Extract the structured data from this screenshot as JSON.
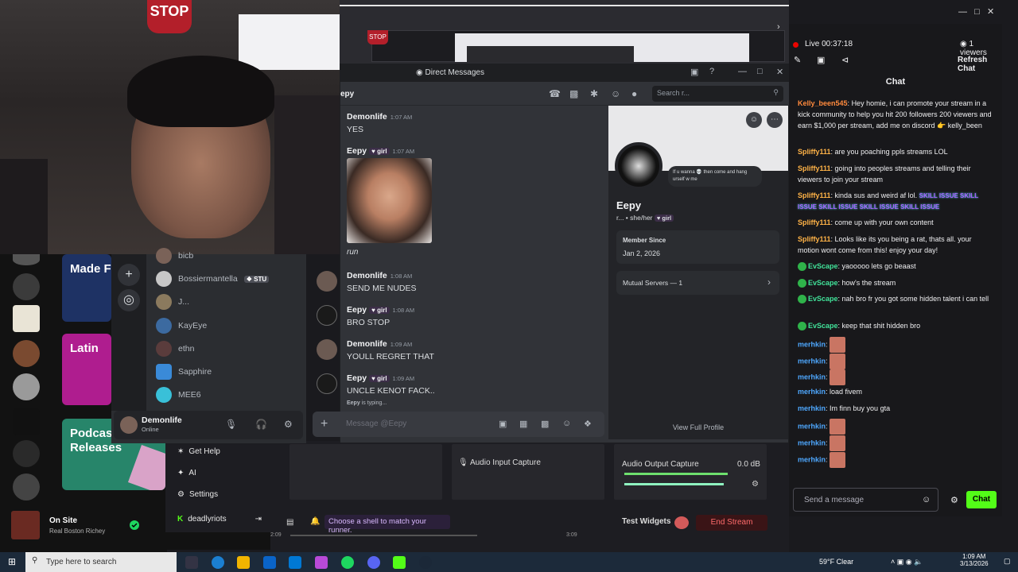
{
  "webcam": {
    "stop_sign": "STOP"
  },
  "obs_strip": {
    "stop_mini": "STOP"
  },
  "spotify": {
    "tiles": [
      {
        "label": "Made F",
        "color": "#1e3264"
      },
      {
        "label": "Latin",
        "color": "#af1d8f"
      },
      {
        "label": "Podcas Releases",
        "color": "#27856a"
      }
    ],
    "now_playing": {
      "title": "On Site",
      "artist": "Real Boston Richey"
    }
  },
  "discord": {
    "window_title": "Direct Messages",
    "channel_name": "epy",
    "search_placeholder": "Search r...",
    "dm_list": [
      {
        "name": "bicb"
      },
      {
        "name": "Bossiermantella",
        "tag": "STU"
      },
      {
        "name": "J..."
      },
      {
        "name": "KayEye"
      },
      {
        "name": "ethn"
      },
      {
        "name": "Sapphire"
      },
      {
        "name": "MEE6"
      }
    ],
    "user": {
      "name": "Demonlife",
      "status": "Online"
    },
    "messages": [
      {
        "author": "Demonlife",
        "time": "1:07 AM",
        "text": "YES"
      },
      {
        "author": "Eepy",
        "badge": "girl",
        "time": "1:07 AM",
        "text": "run"
      },
      {
        "author": "Demonlife",
        "time": "1:08 AM",
        "text": "SEND ME NUDES"
      },
      {
        "author": "Eepy",
        "badge": "girl",
        "time": "1:08 AM",
        "text": "BRO STOP"
      },
      {
        "author": "Demonlife",
        "time": "1:09 AM",
        "text": "YOULL REGRET THAT"
      },
      {
        "author": "Eepy",
        "badge": "girl",
        "time": "1:09 AM",
        "text": "UNCLE KENOT FACK.."
      }
    ],
    "typing_user": "Eepy",
    "typing_suffix": "is typing...",
    "composer_placeholder": "Message @Eepy",
    "profile": {
      "bubble": "If u wanna 💀 then come and hang urself w me",
      "name": "Eepy",
      "pronouns": "r... • she/her",
      "badge": "girl",
      "member_since_label": "Member Since",
      "member_since": "Jan 2, 2026",
      "mutual_servers": "Mutual Servers — 1",
      "view_full": "View Full Profile"
    }
  },
  "stream_chat": {
    "live_text": "Live 00:37:18",
    "viewers": "1 viewers",
    "refresh": "Refresh Chat",
    "title": "Chat",
    "messages": [
      {
        "user": "Kelly_been545",
        "cls": "u-k",
        "text": "Hey homie, i can promote your stream in a kick community to help you hit 200 followers 200 viewers and earn $1,000 per stream, add me on discord 👉 kelly_been"
      },
      {
        "user": "Spliffy111",
        "cls": "u-s",
        "text": "are you poaching ppls streams LOL"
      },
      {
        "user": "Spliffy111",
        "cls": "u-s",
        "text": "going into peoples streams and telling their viewers to join your stream"
      },
      {
        "user": "Spliffy111",
        "cls": "u-s",
        "text": "kinda sus and weird af lol."
      },
      {
        "user": "Spliffy111",
        "cls": "u-s",
        "text": "come up with your own content"
      },
      {
        "user": "Spliffy111",
        "cls": "u-s",
        "text": "Looks like its you being a rat, thats all. your motion wont come from this! enjoy your day!"
      },
      {
        "user": "EvScape",
        "cls": "u-e",
        "text": "yaooooo lets go beaast"
      },
      {
        "user": "EvScape",
        "cls": "u-e",
        "text": "how's the stream"
      },
      {
        "user": "EvScape",
        "cls": "u-e",
        "text": "nah bro fr you got some hidden talent i can tell"
      },
      {
        "user": "EvScape",
        "cls": "u-e",
        "text": "keep that shit hidden bro"
      },
      {
        "user": "merhkin",
        "cls": "u-m",
        "text": ""
      },
      {
        "user": "merhkin",
        "cls": "u-m",
        "text": ""
      },
      {
        "user": "merhkin",
        "cls": "u-m",
        "text": ""
      },
      {
        "user": "merhkin",
        "cls": "u-m",
        "text": "load fivem"
      },
      {
        "user": "merhkin",
        "cls": "u-m",
        "text": "Im finn buy you gta"
      },
      {
        "user": "merhkin",
        "cls": "u-m",
        "text": ""
      },
      {
        "user": "merhkin",
        "cls": "u-m",
        "text": ""
      },
      {
        "user": "merhkin",
        "cls": "u-m",
        "text": ""
      }
    ],
    "skill_emote": "SKILL ISSUE SKILL ISSUE SKILL ISSUE SKILL ISSUE SKILL ISSUE",
    "send_placeholder": "Send a message",
    "chat_button": "Chat"
  },
  "obs": {
    "menu": [
      {
        "label": "Get Help"
      },
      {
        "label": "AI"
      },
      {
        "label": "Settings"
      },
      {
        "label": "deadlyriots"
      }
    ],
    "audio_input": "Audio Input Capture",
    "audio_output": "Audio Output Capture",
    "audio_output_db": "0.0 dB",
    "tip": "Choose a shell to match your runner.",
    "test_widgets": "Test Widgets",
    "end_stream": "End Stream",
    "time_left": "2:09",
    "time_right": "3:09"
  },
  "taskbar": {
    "search_placeholder": "Type here to search",
    "weather": "59°F  Clear",
    "time": "1:09 AM",
    "date": "3/13/2026"
  }
}
